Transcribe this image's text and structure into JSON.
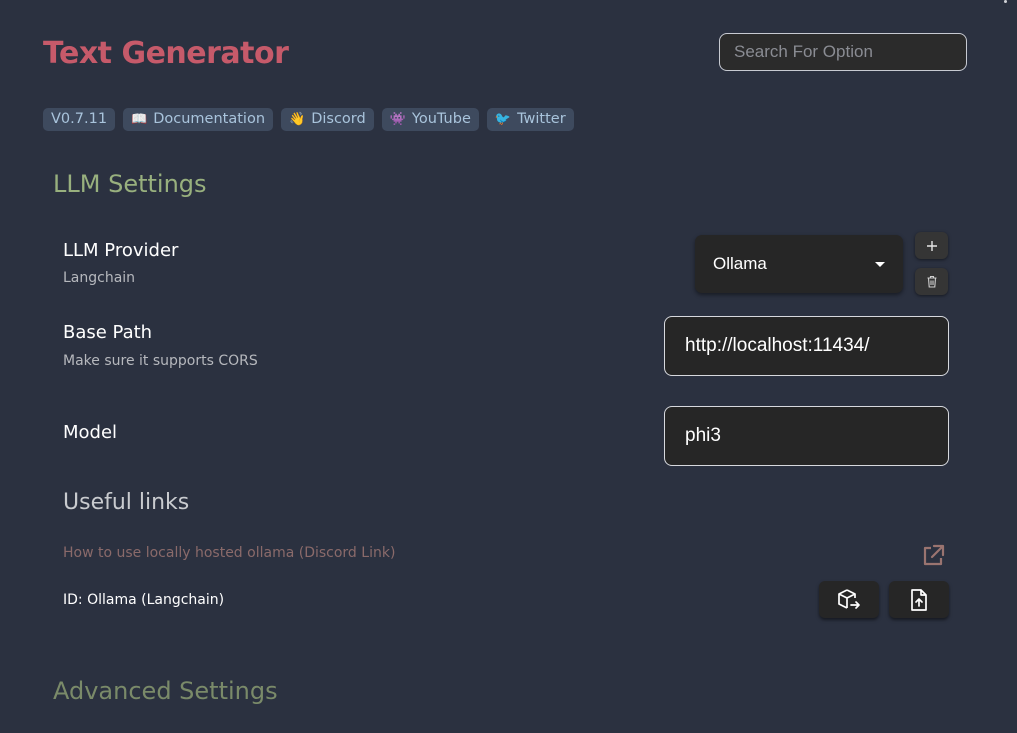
{
  "header": {
    "title": "Text Generator",
    "search_placeholder": "Search For Option"
  },
  "badges": [
    {
      "emoji": "",
      "label": "V0.7.11"
    },
    {
      "emoji": "📖",
      "label": "Documentation"
    },
    {
      "emoji": "👋",
      "label": "Discord"
    },
    {
      "emoji": "👾",
      "label": "YouTube"
    },
    {
      "emoji": "🐦",
      "label": "Twitter"
    }
  ],
  "llm_settings": {
    "title": "LLM Settings",
    "provider": {
      "name": "LLM Provider",
      "description": "Langchain",
      "selected": "Ollama"
    },
    "base_path": {
      "name": "Base Path",
      "description": "Make sure it supports CORS",
      "value": "http://localhost:11434/"
    },
    "model": {
      "name": "Model",
      "value": "phi3"
    },
    "useful_links": {
      "title": "Useful links",
      "link_text": "How to use locally hosted ollama (Discord Link)"
    },
    "id_text": "ID: Ollama (Langchain)"
  },
  "advanced_settings": {
    "title": "Advanced Settings"
  },
  "icons": {
    "add": "plus-icon",
    "delete": "trash-icon",
    "external": "external-link-icon",
    "export": "package-export-icon",
    "upload": "file-upload-icon"
  },
  "colors": {
    "background": "#2b3140",
    "title": "#c65a6a",
    "section_title": "#98b07e",
    "badge_bg": "#3e4a5e",
    "badge_text": "#a9c4dc",
    "link": "#8a6a6a"
  }
}
